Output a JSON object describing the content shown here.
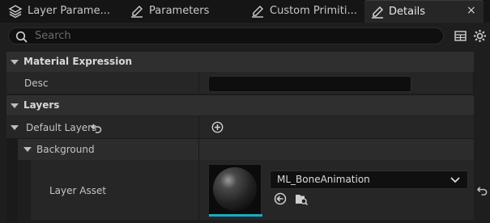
{
  "tabs": [
    {
      "label": "Layer Parame...",
      "icon": "layers-icon"
    },
    {
      "label": "Parameters",
      "icon": "pencil-icon"
    },
    {
      "label": "Custom Primiti...",
      "icon": "pencil-icon"
    },
    {
      "label": "Details",
      "icon": "pencil-icon"
    }
  ],
  "close_symbol": "×",
  "search": {
    "placeholder": "Search"
  },
  "sections": {
    "material_expression": "Material Expression",
    "layers": "Layers"
  },
  "rows": {
    "desc": {
      "label": "Desc",
      "value": ""
    },
    "default_layers": {
      "label": "Default Layers"
    },
    "background": {
      "label": "Background"
    },
    "layer_asset": {
      "label": "Layer Asset",
      "value": "ML_BoneAnimation"
    }
  },
  "colors": {
    "accent": "#1aa9c6",
    "panel": "#1e1e1e",
    "header": "#2f2f2f"
  }
}
